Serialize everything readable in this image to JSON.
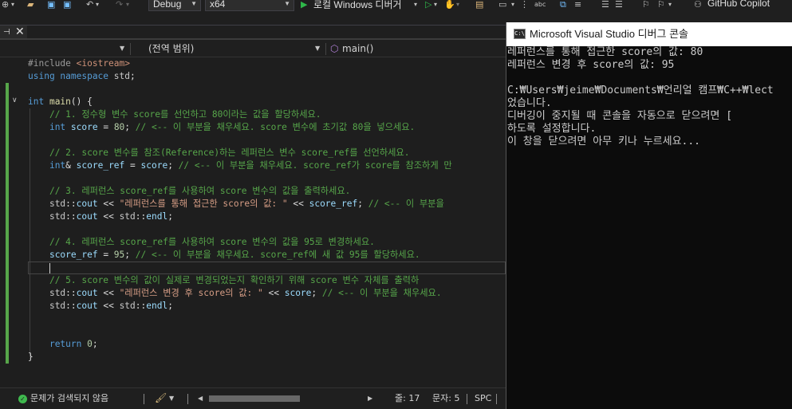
{
  "toolbar": {
    "config": "Debug",
    "platform": "x64",
    "run_label": "로컬 Windows 디버거",
    "copilot_label": "GitHub Copilot"
  },
  "navbar": {
    "scope": "(전역 범위)",
    "member": "main()"
  },
  "code_lines": [
    [
      [
        "c-pp",
        "#include "
      ],
      [
        "c-inc",
        "<iostream>"
      ]
    ],
    [
      [
        "c-kw",
        "using namespace "
      ],
      [
        "c-ns",
        "std"
      ],
      [
        "c-plain",
        ";"
      ]
    ],
    [],
    [
      [
        "c-kw",
        "int "
      ],
      [
        "c-fn",
        "main"
      ],
      [
        "c-plain",
        "() {"
      ]
    ],
    [
      [
        "c-plain",
        "    "
      ],
      [
        "c-cm",
        "// 1. 정수형 변수 score를 선언하고 80이라는 값을 할당하세요."
      ]
    ],
    [
      [
        "c-plain",
        "    "
      ],
      [
        "c-kw",
        "int "
      ],
      [
        "c-var",
        "score"
      ],
      [
        "c-plain",
        " = "
      ],
      [
        "c-num",
        "80"
      ],
      [
        "c-plain",
        "; "
      ],
      [
        "c-cm",
        "// <-- 이 부분을 채우세요. score 변수에 초기값 80을 넣으세요."
      ]
    ],
    [],
    [
      [
        "c-plain",
        "    "
      ],
      [
        "c-cm",
        "// 2. score 변수를 참조(Reference)하는 레퍼런스 변수 score_ref를 선언하세요."
      ]
    ],
    [
      [
        "c-plain",
        "    "
      ],
      [
        "c-kw",
        "int"
      ],
      [
        "c-plain",
        "& "
      ],
      [
        "c-var",
        "score_ref"
      ],
      [
        "c-plain",
        " = "
      ],
      [
        "c-var",
        "score"
      ],
      [
        "c-plain",
        "; "
      ],
      [
        "c-cm",
        "// <-- 이 부분을 채우세요. score_ref가 score를 참조하게 만"
      ]
    ],
    [],
    [
      [
        "c-plain",
        "    "
      ],
      [
        "c-cm",
        "// 3. 레퍼런스 score_ref를 사용하여 score 변수의 값을 출력하세요."
      ]
    ],
    [
      [
        "c-plain",
        "    "
      ],
      [
        "c-ns",
        "std"
      ],
      [
        "c-plain",
        "::"
      ],
      [
        "c-var",
        "cout"
      ],
      [
        "c-plain",
        " << "
      ],
      [
        "c-str",
        "\"레퍼런스를 통해 접근한 score의 값: \""
      ],
      [
        "c-plain",
        " << "
      ],
      [
        "c-var",
        "score_ref"
      ],
      [
        "c-plain",
        "; "
      ],
      [
        "c-cm",
        "// <-- 이 부분을"
      ]
    ],
    [
      [
        "c-plain",
        "    "
      ],
      [
        "c-ns",
        "std"
      ],
      [
        "c-plain",
        "::"
      ],
      [
        "c-var",
        "cout"
      ],
      [
        "c-plain",
        " << "
      ],
      [
        "c-ns",
        "std"
      ],
      [
        "c-plain",
        "::"
      ],
      [
        "c-var",
        "endl"
      ],
      [
        "c-plain",
        ";"
      ]
    ],
    [],
    [
      [
        "c-plain",
        "    "
      ],
      [
        "c-cm",
        "// 4. 레퍼런스 score_ref를 사용하여 score 변수의 값을 95로 변경하세요."
      ]
    ],
    [
      [
        "c-plain",
        "    "
      ],
      [
        "c-var",
        "score_ref"
      ],
      [
        "c-plain",
        " = "
      ],
      [
        "c-num",
        "95"
      ],
      [
        "c-plain",
        "; "
      ],
      [
        "c-cm",
        "// <-- 이 부분을 채우세요. score_ref에 새 값 95를 할당하세요."
      ]
    ],
    [],
    [
      [
        "c-plain",
        "    "
      ],
      [
        "c-cm",
        "// 5. score 변수의 값이 실제로 변경되었는지 확인하기 위해 score 변수 자체를 출력하"
      ]
    ],
    [
      [
        "c-plain",
        "    "
      ],
      [
        "c-ns",
        "std"
      ],
      [
        "c-plain",
        "::"
      ],
      [
        "c-var",
        "cout"
      ],
      [
        "c-plain",
        " << "
      ],
      [
        "c-str",
        "\"레퍼런스 변경 후 score의 값: \""
      ],
      [
        "c-plain",
        " << "
      ],
      [
        "c-var",
        "score"
      ],
      [
        "c-plain",
        "; "
      ],
      [
        "c-cm",
        "// <-- 이 부분을 채우세요."
      ]
    ],
    [
      [
        "c-plain",
        "    "
      ],
      [
        "c-ns",
        "std"
      ],
      [
        "c-plain",
        "::"
      ],
      [
        "c-var",
        "cout"
      ],
      [
        "c-plain",
        " << "
      ],
      [
        "c-ns",
        "std"
      ],
      [
        "c-plain",
        "::"
      ],
      [
        "c-var",
        "endl"
      ],
      [
        "c-plain",
        ";"
      ]
    ],
    [],
    [],
    [
      [
        "c-plain",
        "    "
      ],
      [
        "c-kw",
        "return "
      ],
      [
        "c-num",
        "0"
      ],
      [
        "c-plain",
        ";"
      ]
    ],
    [
      [
        "c-plain",
        "}"
      ]
    ]
  ],
  "status": {
    "issues": "문제가 검색되지 않음",
    "line": "줄: 17",
    "col": "문자: 5",
    "mode": "SPC"
  },
  "console": {
    "title": "Microsoft Visual Studio 디버그 콘솔",
    "icon_label": "C:\\",
    "lines": [
      "레퍼런스를 통해 접근한 score의 값: 80",
      "레퍼런스 변경 후 score의 값: 95",
      "",
      "C:₩Users₩jeime₩Documents₩언리얼 캠프₩C++₩lect",
      "었습니다.",
      "디버깅이 중지될 때 콘솔을 자동으로 닫으려면 [",
      "하도록 설정합니다.",
      "이 창을 닫으려면 아무 키나 누르세요..."
    ]
  }
}
